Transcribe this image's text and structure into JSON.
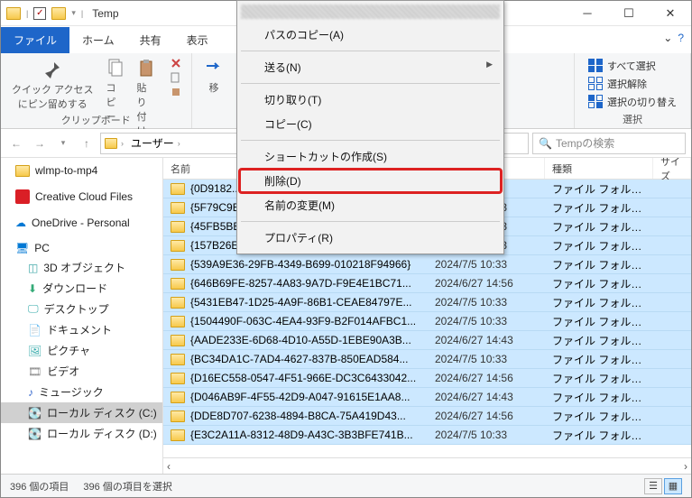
{
  "title": "Temp",
  "tabs": {
    "file": "ファイル",
    "home": "ホーム",
    "share": "共有",
    "view": "表示"
  },
  "ribbon": {
    "clipboard": {
      "quick": "クイック アクセス\nにピン留めする",
      "copy": "コピー",
      "paste": "貼り付け",
      "label": "クリップボード",
      "move": "移"
    },
    "select": {
      "all": "すべて選択",
      "none": "選択解除",
      "invert": "選択の切り替え",
      "label": "選択"
    }
  },
  "address": {
    "crumb1": "ユーザー",
    "search": "Tempの検索"
  },
  "tree": {
    "wlmp": "wlmp-to-mp4",
    "ccf": "Creative Cloud Files",
    "od": "OneDrive - Personal",
    "pc": "PC",
    "obj": "3D オブジェクト",
    "dl": "ダウンロード",
    "desk": "デスクトップ",
    "doc": "ドキュメント",
    "pic": "ピクチャ",
    "vid": "ビデオ",
    "mus": "ミュージック",
    "c": "ローカル ディスク (C:)",
    "d": "ローカル ディスク (D:)"
  },
  "columns": {
    "name": "名前",
    "type": "種類",
    "size": "サイズ"
  },
  "rows": [
    {
      "name": "{0D9182...-...-...-...-...}",
      "date": "2024/.../...",
      "type": "ファイル フォルダー"
    },
    {
      "name": "{5F79C9E3-7056-4F77-97EA-9A3D6CA4295...",
      "date": "2024/7/5 10:33",
      "type": "ファイル フォルダー"
    },
    {
      "name": "{45FB5BE8-15B3-4DA3-8C92-F37FCF32E4...",
      "date": "2024/7/5 10:33",
      "type": "ファイル フォルダー"
    },
    {
      "name": "{157B26EF-6453-4FE6-BA23-423722A048C...",
      "date": "2024/7/5 10:33",
      "type": "ファイル フォルダー"
    },
    {
      "name": "{539A9E36-29FB-4349-B699-010218F94966}",
      "date": "2024/7/5 10:33",
      "type": "ファイル フォルダー"
    },
    {
      "name": "{646B69FE-8257-4A83-9A7D-F9E4E1BC71...",
      "date": "2024/6/27 14:56",
      "type": "ファイル フォルダー"
    },
    {
      "name": "{5431EB47-1D25-4A9F-86B1-CEAE84797E...",
      "date": "2024/7/5 10:33",
      "type": "ファイル フォルダー"
    },
    {
      "name": "{1504490F-063C-4EA4-93F9-B2F014AFBC1...",
      "date": "2024/7/5 10:33",
      "type": "ファイル フォルダー"
    },
    {
      "name": "{AADE233E-6D68-4D10-A55D-1EBE90A3B...",
      "date": "2024/6/27 14:43",
      "type": "ファイル フォルダー"
    },
    {
      "name": "{BC34DA1C-7AD4-4627-837B-850EAD584...",
      "date": "2024/7/5 10:33",
      "type": "ファイル フォルダー"
    },
    {
      "name": "{D16EC558-0547-4F51-966E-DC3C6433042...",
      "date": "2024/6/27 14:56",
      "type": "ファイル フォルダー"
    },
    {
      "name": "{D046AB9F-4F55-42D9-A047-91615E1AA8...",
      "date": "2024/6/27 14:43",
      "type": "ファイル フォルダー"
    },
    {
      "name": "{DDE8D707-6238-4894-B8CA-75A419D43...",
      "date": "2024/6/27 14:56",
      "type": "ファイル フォルダー"
    },
    {
      "name": "{E3C2A11A-8312-48D9-A43C-3B3BFE741B...",
      "date": "2024/7/5 10:33",
      "type": "ファイル フォルダー"
    }
  ],
  "context": {
    "pathcopy": "パスのコピー(A)",
    "send": "送る(N)",
    "cut": "切り取り(T)",
    "copy": "コピー(C)",
    "shortcut": "ショートカットの作成(S)",
    "delete": "削除(D)",
    "rename": "名前の変更(M)",
    "props": "プロパティ(R)"
  },
  "status": {
    "count": "396 個の項目",
    "selected": "396 個の項目を選択"
  }
}
